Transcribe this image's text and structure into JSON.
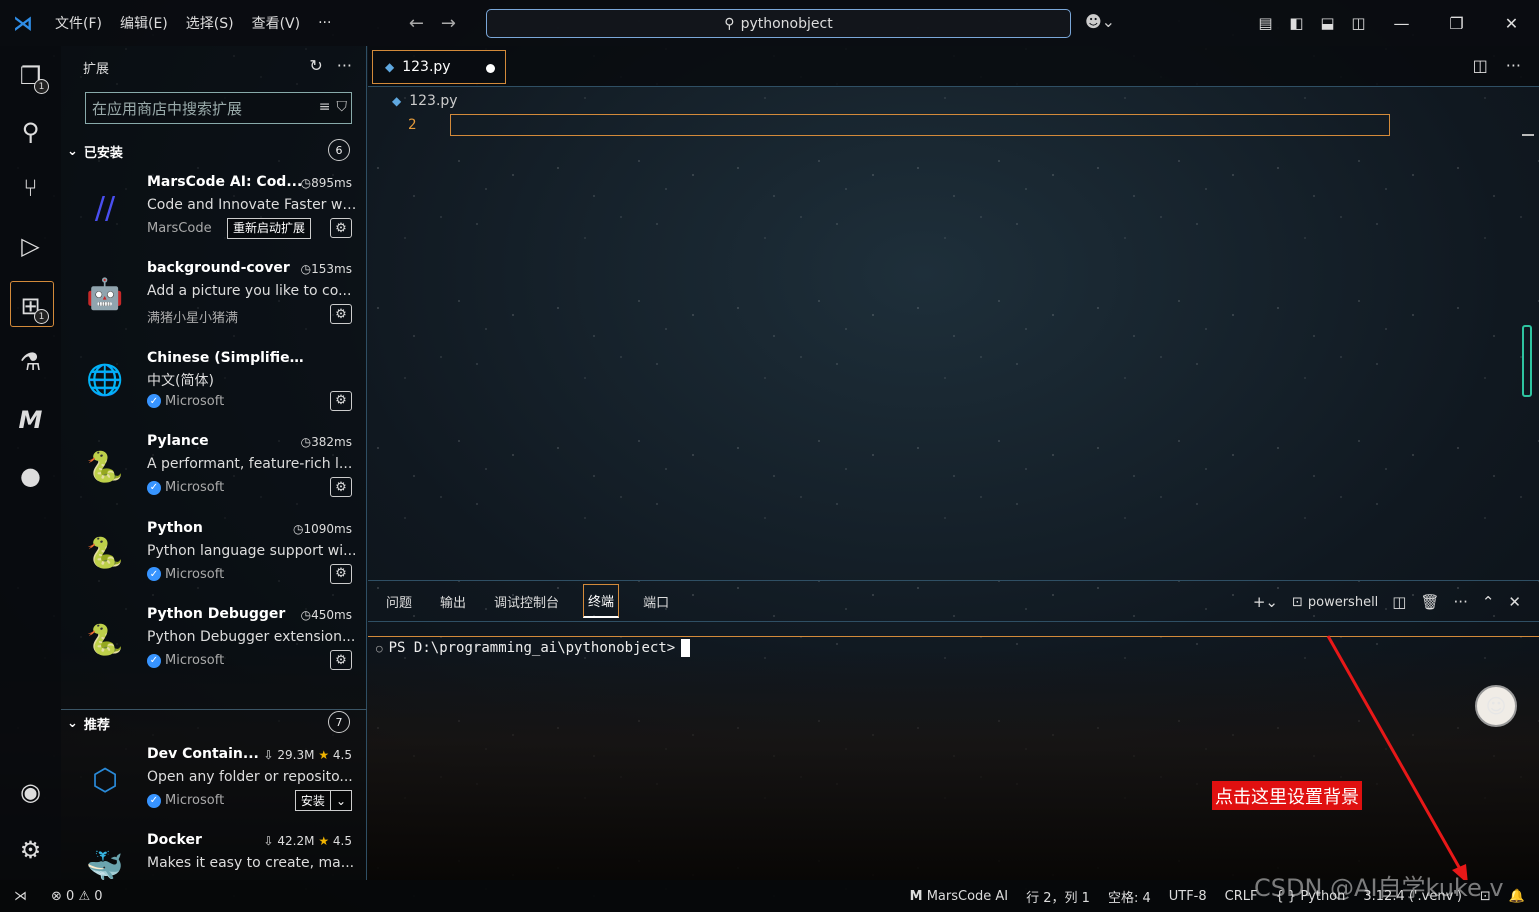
{
  "titlebar": {
    "menus": [
      "文件(F)",
      "编辑(E)",
      "选择(S)",
      "查看(V)",
      "···"
    ],
    "search_text": "pythonobject"
  },
  "activity": {
    "explorer_badge": "1",
    "extensions_badge": "1"
  },
  "sidebar": {
    "title": "扩展",
    "search_placeholder": "在应用商店中搜索扩展",
    "installed": {
      "label": "已安装",
      "count": "6",
      "items": [
        {
          "name": "MarsCode AI: Cod...",
          "meta": "895ms",
          "desc": "Code and Innovate Faster wi...",
          "publisher": "MarsCode",
          "verified": false,
          "button": "重新启动扩展",
          "icon": "marscode-icon",
          "color": "#4a4ff0"
        },
        {
          "name": "background-cover",
          "meta": "153ms",
          "desc": "Add a picture you like to co...",
          "publisher": "满猪小星小猪满",
          "verified": false,
          "icon": "robot-icon",
          "color": "#6a4ad0"
        },
        {
          "name": "Chinese (Simplified) (简体...",
          "meta": "",
          "desc": "中文(简体)",
          "publisher": "Microsoft",
          "verified": true,
          "icon": "globe-icon",
          "color": "#d8d8d8"
        },
        {
          "name": "Pylance",
          "meta": "382ms",
          "desc": "A performant, feature-rich l...",
          "publisher": "Microsoft",
          "verified": true,
          "icon": "python-icon",
          "color": "#3a74b8"
        },
        {
          "name": "Python",
          "meta": "1090ms",
          "desc": "Python language support wi...",
          "publisher": "Microsoft",
          "verified": true,
          "icon": "python-icon",
          "color": "#3a74b8"
        },
        {
          "name": "Python Debugger",
          "meta": "450ms",
          "desc": "Python Debugger extension...",
          "publisher": "Microsoft",
          "verified": true,
          "icon": "python-icon",
          "color": "#3a74b8"
        }
      ]
    },
    "recommended": {
      "label": "推荐",
      "count": "7",
      "items": [
        {
          "name": "Dev Contain...",
          "downloads": "29.3M",
          "rating": "4.5",
          "desc": "Open any folder or reposito...",
          "publisher": "Microsoft",
          "verified": true,
          "button": "安装",
          "icon": "container-icon",
          "color": "#2a8ad8"
        },
        {
          "name": "Docker",
          "downloads": "42.2M",
          "rating": "4.5",
          "desc": "Makes it easy to create, ma...",
          "publisher": "",
          "icon": "docker-icon",
          "color": "#1d90e0"
        }
      ]
    }
  },
  "editor": {
    "tab_label": "123.py",
    "breadcrumb": "123.py",
    "line_number": "2"
  },
  "panel": {
    "tabs": [
      "问题",
      "输出",
      "调试控制台",
      "终端",
      "端口"
    ],
    "active_tab": "终端",
    "shell": "powershell",
    "prompt": "PS D:\\programming_ai\\pythonobject>"
  },
  "annotation": "点击这里设置背景",
  "statusbar": {
    "errors": "0",
    "warnings": "0",
    "marscode": "MarsCode AI",
    "position": "行 2，列 1",
    "spaces": "空格: 4",
    "encoding": "UTF-8",
    "eol": "CRLF",
    "language": "Python",
    "interpreter": "3.12.4 ('.venv')"
  },
  "watermark": "CSDN @AI自学kuke v"
}
